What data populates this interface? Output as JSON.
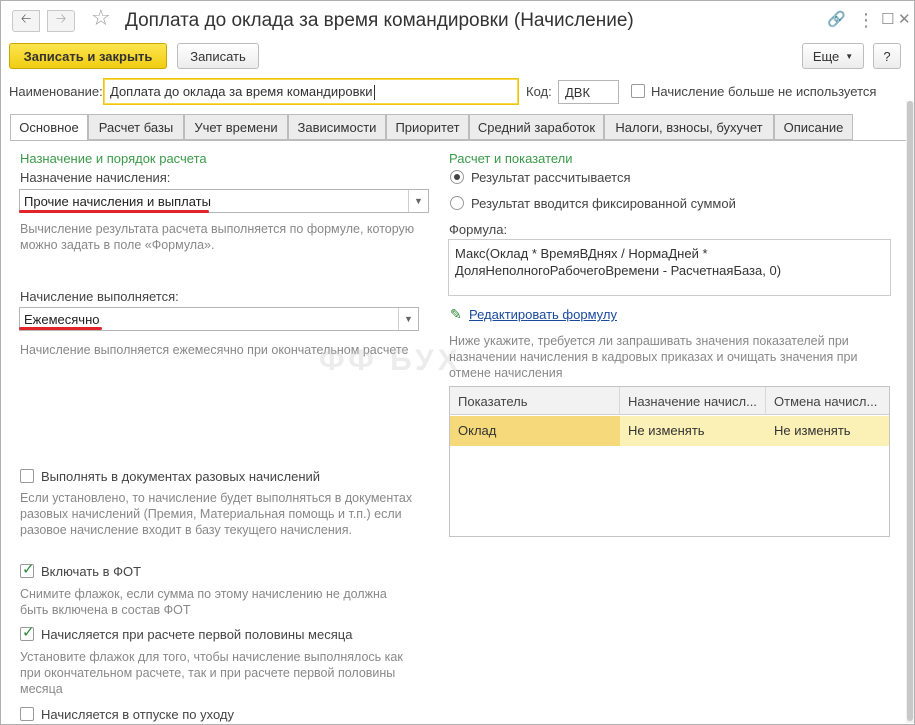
{
  "window": {
    "title": "Доплата до оклада за время командировки (Начисление)"
  },
  "toolbar": {
    "save_close_label": "Записать и закрыть",
    "save_label": "Записать",
    "more_label": "Еще",
    "help_label": "?"
  },
  "header": {
    "name_label": "Наименование:",
    "name_value": "Доплата до оклада за время командировки",
    "code_label": "Код:",
    "code_value": "ДВК",
    "not_used_label": "Начисление больше не используется"
  },
  "tabs": [
    {
      "label": "Основное",
      "active": true
    },
    {
      "label": "Расчет базы"
    },
    {
      "label": "Учет времени"
    },
    {
      "label": "Зависимости"
    },
    {
      "label": "Приоритет"
    },
    {
      "label": "Средний заработок"
    },
    {
      "label": "Налоги, взносы, бухучет"
    },
    {
      "label": "Описание"
    }
  ],
  "left": {
    "section_title": "Назначение и порядок расчета",
    "purpose_label": "Назначение начисления:",
    "purpose_value": "Прочие начисления и выплаты",
    "purpose_hint": "Вычисление результата расчета выполняется по формуле, которую можно задать в поле «Формула».",
    "period_label": "Начисление выполняется:",
    "period_value": "Ежемесячно",
    "period_hint": "Начисление выполняется ежемесячно при окончательном расчете",
    "one_time_label": "Выполнять в документах разовых начислений",
    "one_time_hint": "Если установлено, то начисление будет выполняться в документах разовых начислений (Премия, Материальная помощь и т.п.) если разовое начисление входит в базу текущего начисления.",
    "fot_label": "Включать в ФОТ",
    "fot_hint": "Снимите флажок, если сумма по этому начислению не должна быть включена в состав ФОТ",
    "first_half_label": "Начисляется при расчете первой половины месяца",
    "first_half_hint": "Установите флажок для того, чтобы начисление выполнялось как при окончательном расчете, так и при расчете первой половины месяца",
    "leave_label": "Начисляется в отпуске по уходу"
  },
  "right": {
    "section_title": "Расчет и показатели",
    "radio_calc_label": "Результат рассчитывается",
    "radio_fixed_label": "Результат вводится фиксированной суммой",
    "formula_label": "Формула:",
    "formula_line1": "Макс(Оклад * ВремяВДнях / НормаДней *",
    "formula_line2": "ДоляНеполногоРабочегоВремени - РасчетнаяБаза, 0)",
    "edit_formula_link": "Редактировать формулу",
    "indicators_hint": "Ниже укажите, требуется ли запрашивать значения показателей при назначении начисления в кадровых приказах и очищать значения при отмене начисления"
  },
  "table": {
    "columns": [
      "Показатель",
      "Назначение начисл...",
      "Отмена начисл..."
    ],
    "rows": [
      [
        "Оклад",
        "Не изменять",
        "Не изменять"
      ]
    ]
  },
  "watermark": "БУХ",
  "icons": {
    "back": "arrow-left-icon",
    "forward": "arrow-right-icon",
    "favorite": "star-icon",
    "link": "link-icon",
    "menu": "more-vertical-icon",
    "maximize": "maximize-icon",
    "close": "close-icon",
    "edit": "pencil-icon"
  }
}
